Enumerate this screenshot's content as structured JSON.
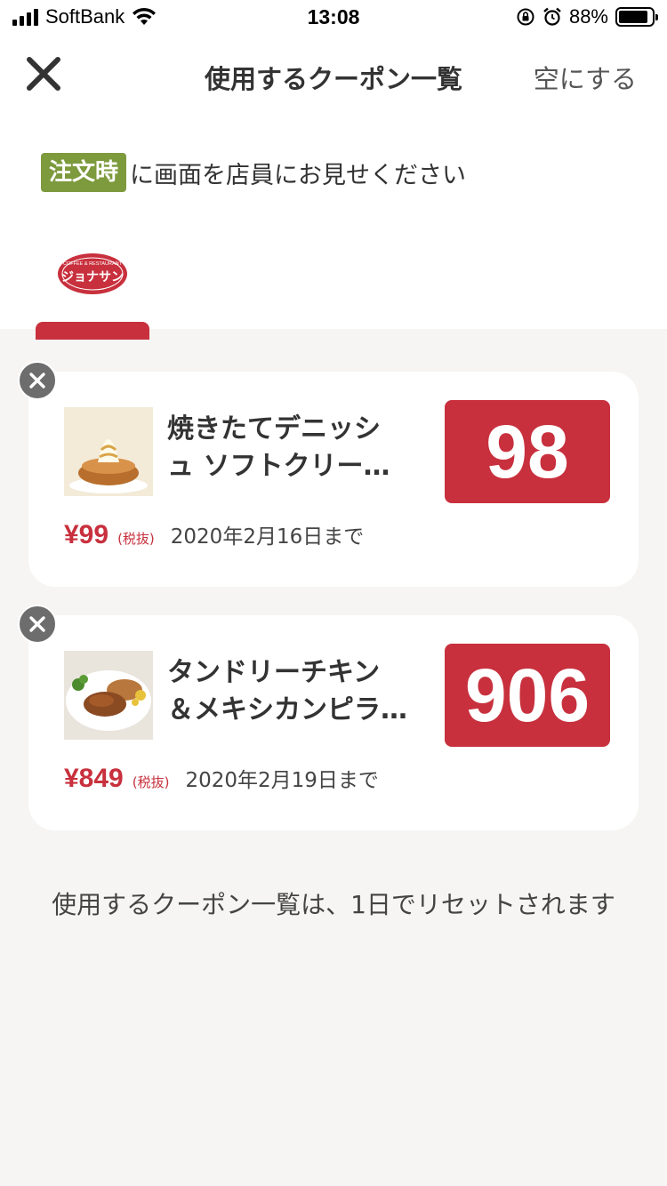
{
  "status_bar": {
    "carrier": "SoftBank",
    "time": "13:08",
    "battery_pct": "88%"
  },
  "header": {
    "title": "使用するクーポン一覧",
    "empty_label": "空にする",
    "close_icon": "close-icon"
  },
  "instruction": {
    "badge": "注文時",
    "text": "に画面を店員にお見せください"
  },
  "logo": {
    "top_text": "COFFEE & RESTAURANT",
    "name": "ジョナサン"
  },
  "coupons": [
    {
      "name_line1": "焼きたてデニッシ",
      "name_line2": "ュ ソフトクリー…",
      "price": "98",
      "orig_price": "¥99",
      "tax_note": "(税抜)",
      "expiry": "2020年2月16日まで"
    },
    {
      "name_line1": "タンドリーチキン",
      "name_line2": "＆メキシカンピラ…",
      "price": "906",
      "orig_price": "¥849",
      "tax_note": "(税抜)",
      "expiry": "2020年2月19日まで"
    }
  ],
  "footer_note": "使用するクーポン一覧は、1日でリセットされます",
  "colors": {
    "accent_red": "#c8303d",
    "badge_green": "#7d9a3d",
    "background": "#f6f5f3"
  }
}
